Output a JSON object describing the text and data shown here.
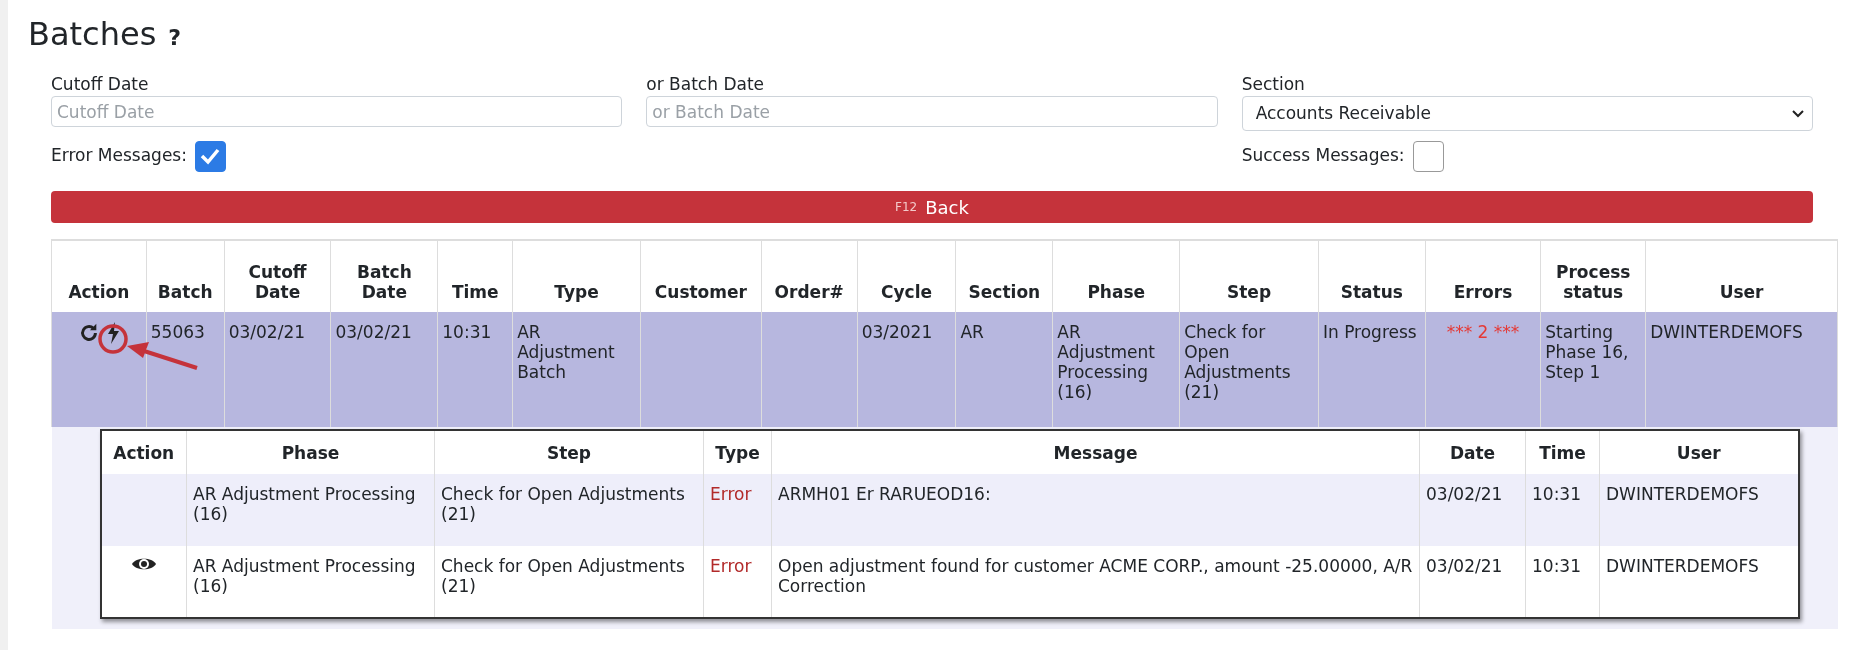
{
  "page": {
    "title": "Batches",
    "help": "?"
  },
  "filters": {
    "cutoff_date": {
      "label": "Cutoff Date",
      "placeholder": "Cutoff Date"
    },
    "batch_date": {
      "label": "or Batch Date",
      "placeholder": "or Batch Date"
    },
    "section": {
      "label": "Section",
      "value": "Accounts Receivable"
    },
    "error_messages": {
      "label": "Error Messages:",
      "checked": true
    },
    "success_messages": {
      "label": "Success Messages:",
      "checked": false
    }
  },
  "back_button": {
    "key_hint": "F12",
    "label": "Back"
  },
  "table": {
    "columns": [
      "Action",
      "Batch",
      "Cutoff Date",
      "Batch Date",
      "Time",
      "Type",
      "Customer",
      "Order#",
      "Cycle",
      "Section",
      "Phase",
      "Step",
      "Status",
      "Errors",
      "Process status",
      "User"
    ],
    "rows": [
      {
        "selected": true,
        "batch": "55063",
        "cutoff_date": "03/02/21",
        "batch_date": "03/02/21",
        "time": "10:31",
        "type": "AR Adjustment Batch",
        "cycle": "03/2021",
        "section": "AR",
        "phase": "AR Adjustment Processing (16)",
        "step": "Check for Open Adjustments (21)",
        "status": "In Progress",
        "errors": "*** 2 ***",
        "process_status": "Starting Phase 16, Step 1",
        "user": "DWINTERDEMOFS",
        "messages": {
          "columns": [
            "Action",
            "Phase",
            "Step",
            "Type",
            "Message",
            "Date",
            "Time",
            "User"
          ],
          "rows": [
            {
              "viewable": false,
              "phase": "AR Adjustment Processing (16)",
              "step": "Check for Open Adjustments (21)",
              "type": "Error",
              "message": "ARMH01 Er RARUEOD16:",
              "date": "03/02/21",
              "time": "10:31",
              "user": "DWINTERDEMOFS"
            },
            {
              "viewable": true,
              "phase": "AR Adjustment Processing (16)",
              "step": "Check for Open Adjustments (21)",
              "type": "Error",
              "message": "Open adjustment found for customer ACME CORP., amount -25.00000, A/R Correction",
              "date": "03/02/21",
              "time": "10:31",
              "user": "DWINTERDEMOFS"
            }
          ]
        }
      }
    ]
  }
}
